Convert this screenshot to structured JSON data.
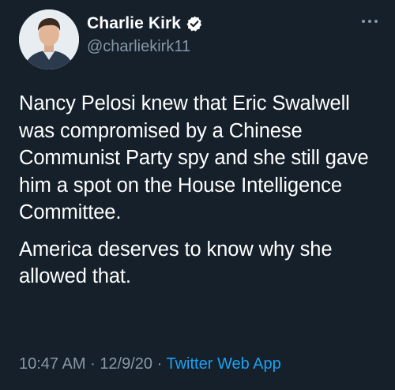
{
  "author": {
    "display_name": "Charlie Kirk",
    "handle": "@charliekirk11",
    "verified": true,
    "avatar_icon": "profile-photo"
  },
  "tweet": {
    "paragraphs": [
      "Nancy Pelosi knew that Eric Swalwell was compromised by a Chinese Communist Party spy and she still gave him a spot on the House Intelligence Committee.",
      "America deserves to know why she allowed that."
    ]
  },
  "meta": {
    "time": "10:47 AM",
    "date": "12/9/20",
    "separator": "·",
    "source": "Twitter Web App"
  },
  "colors": {
    "background": "#15202b",
    "text": "#ffffff",
    "secondary": "#8899a6",
    "accent": "#1da1f2"
  },
  "icons": {
    "verified": "verified-badge-icon",
    "more": "more-options-icon"
  }
}
